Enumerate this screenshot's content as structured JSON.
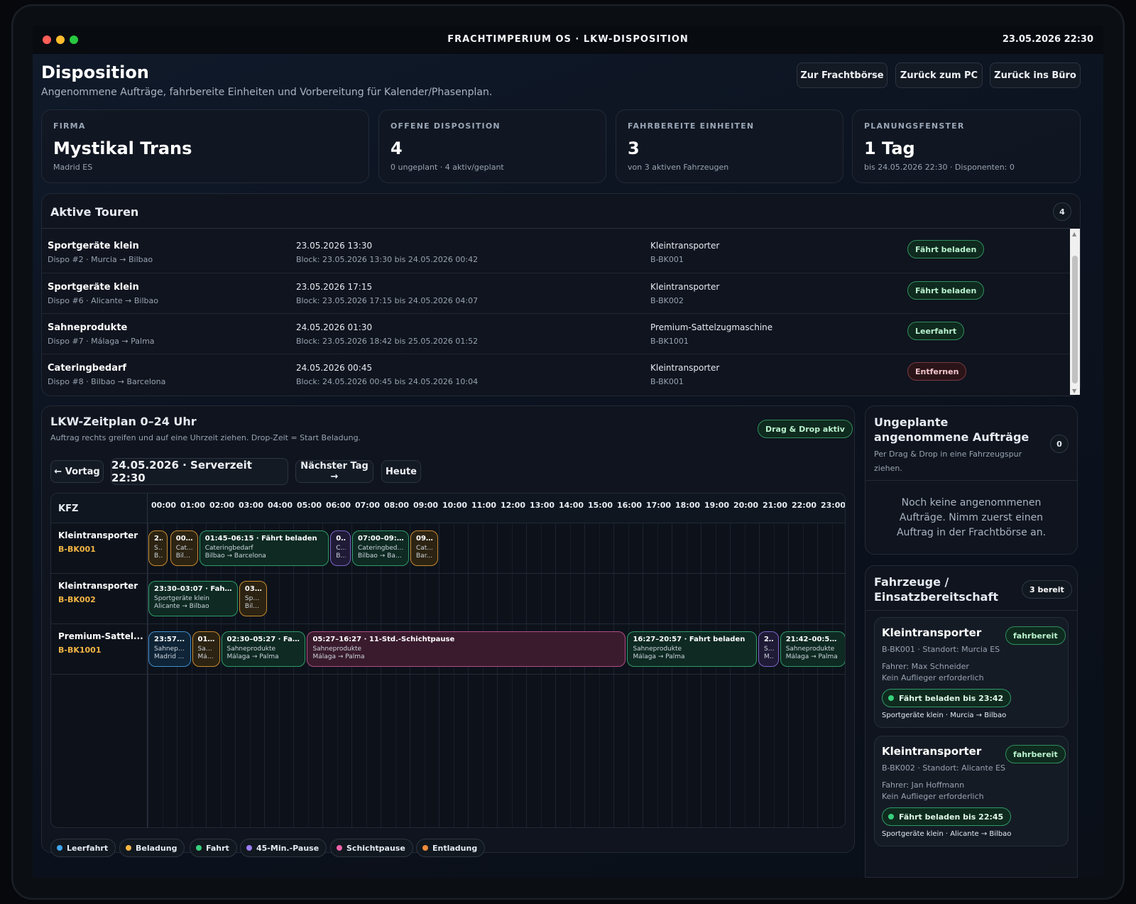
{
  "window": {
    "title": "FRACHTIMPERIUM OS · LKW-DISPOSITION",
    "datetime": "23.05.2026 22:30"
  },
  "header": {
    "title": "Disposition",
    "subtitle": "Angenommene Aufträge, fahrbereite Einheiten und Vorbereitung für Kalender/Phasenplan.",
    "buttons": {
      "freight": "Zur Frachtbörse",
      "pc": "Zurück zum PC",
      "office": "Zurück ins Büro"
    }
  },
  "stats": [
    {
      "label": "FIRMA",
      "value": "Mystikal Trans",
      "sub": "Madrid ES"
    },
    {
      "label": "OFFENE DISPOSITION",
      "value": "4",
      "sub": "0 ungeplant · 4 aktiv/geplant"
    },
    {
      "label": "FAHRBEREITE EINHEITEN",
      "value": "3",
      "sub": "von 3 aktiven Fahrzeugen"
    },
    {
      "label": "PLANUNGSFENSTER",
      "value": "1 Tag",
      "sub": "bis 24.05.2026 22:30 · Disponenten: 0"
    }
  ],
  "tours": {
    "title": "Aktive Touren",
    "count": "4",
    "rows": [
      {
        "cargo": "Sportgeräte klein",
        "dispo": "Dispo #2 · Murcia → Bilbao",
        "time": "23.05.2026 13:30",
        "block": "Block: 23.05.2026 13:30 bis 24.05.2026 00:42",
        "vehicle": "Kleintransporter",
        "plate": "B-BK001",
        "status": "Fährt beladen",
        "status_type": "green"
      },
      {
        "cargo": "Sportgeräte klein",
        "dispo": "Dispo #6 · Alicante → Bilbao",
        "time": "23.05.2026 17:15",
        "block": "Block: 23.05.2026 17:15 bis 24.05.2026 04:07",
        "vehicle": "Kleintransporter",
        "plate": "B-BK002",
        "status": "Fährt beladen",
        "status_type": "green"
      },
      {
        "cargo": "Sahneprodukte",
        "dispo": "Dispo #7 · Málaga → Palma",
        "time": "24.05.2026 01:30",
        "block": "Block: 23.05.2026 18:42 bis 25.05.2026 01:52",
        "vehicle": "Premium-Sattelzugmaschine",
        "plate": "B-BK1001",
        "status": "Leerfahrt",
        "status_type": "green"
      },
      {
        "cargo": "Cateringbedarf",
        "dispo": "Dispo #8 · Bilbao → Barcelona",
        "time": "24.05.2026 00:45",
        "block": "Block: 24.05.2026 00:45 bis 24.05.2026 10:04",
        "vehicle": "Kleintransporter",
        "plate": "B-BK001",
        "status": "Entfernen",
        "status_type": "red"
      }
    ]
  },
  "schedule": {
    "title": "LKW-Zeitplan 0–24 Uhr",
    "subtitle": "Auftrag rechts greifen und auf eine Uhrzeit ziehen. Drop-Zeit = Start Beladung.",
    "dnd_badge": "Drag & Drop aktiv",
    "prev_day": "← Vortag",
    "current": "24.05.2026 · Serverzeit 22:30",
    "next_day": "Nächster Tag →",
    "today": "Heute",
    "kfz_header": "KFZ",
    "hours": [
      "00:00",
      "01:00",
      "02:00",
      "03:00",
      "04:00",
      "05:00",
      "06:00",
      "07:00",
      "08:00",
      "09:00",
      "10:00",
      "11:00",
      "12:00",
      "13:00",
      "14:00",
      "15:00",
      "16:00",
      "17:00",
      "18:00",
      "19:00",
      "20:00",
      "21:00",
      "22:00",
      "23:00"
    ],
    "rows": [
      {
        "name": "Kleintransporter",
        "plate": "B-BK001",
        "blocks": [
          {
            "start": 0.0,
            "end": 0.7,
            "kind": "orange",
            "title": "2...",
            "sub": "S...",
            "route": "B..."
          },
          {
            "start": 0.75,
            "end": 1.75,
            "kind": "orange",
            "title": "00...",
            "sub": "Cat...",
            "route": "Bilb..."
          },
          {
            "start": 1.75,
            "end": 6.25,
            "kind": "green",
            "title": "01:45–06:15 · Fährt beladen",
            "sub": "Cateringbedarf",
            "route": "Bilbao → Barcelona"
          },
          {
            "start": 6.25,
            "end": 7.0,
            "kind": "purple",
            "title": "0...",
            "sub": "C...",
            "route": "B..."
          },
          {
            "start": 7.0,
            "end": 9.0,
            "kind": "green",
            "title": "07:00–09:0...",
            "sub": "Cateringbedarf",
            "route": "Bilbao → Barc..."
          },
          {
            "start": 9.0,
            "end": 10.0,
            "kind": "orange",
            "title": "09...",
            "sub": "Cat...",
            "route": "Bar..."
          }
        ]
      },
      {
        "name": "Kleintransporter",
        "plate": "B-BK002",
        "blocks": [
          {
            "start": 0.0,
            "end": 3.12,
            "kind": "green",
            "title": "23:30–03:07 · Fahr...",
            "sub": "Sportgeräte klein",
            "route": "Alicante → Bilbao"
          },
          {
            "start": 3.12,
            "end": 4.12,
            "kind": "orange",
            "title": "03...",
            "sub": "Spo...",
            "route": "Bilb..."
          }
        ]
      },
      {
        "name": "Premium-Sattel...",
        "plate": "B-BK1001",
        "blocks": [
          {
            "start": 0.0,
            "end": 1.5,
            "kind": "blue",
            "title": "23:57...",
            "sub": "Sahnepr...",
            "route": "Madrid ..."
          },
          {
            "start": 1.5,
            "end": 2.5,
            "kind": "orange",
            "title": "01...",
            "sub": "Sah...",
            "route": "Mál..."
          },
          {
            "start": 2.5,
            "end": 5.45,
            "kind": "green",
            "title": "02:30–05:27 · Fah...",
            "sub": "Sahneprodukte",
            "route": "Málaga → Palma"
          },
          {
            "start": 5.45,
            "end": 16.45,
            "kind": "pink",
            "title": "05:27–16:27 · 11-Std.-Schichtpause",
            "sub": "Sahneprodukte",
            "route": "Málaga → Palma"
          },
          {
            "start": 16.45,
            "end": 20.95,
            "kind": "green",
            "title": "16:27–20:57 · Fahrt beladen",
            "sub": "Sahneprodukte",
            "route": "Málaga → Palma"
          },
          {
            "start": 20.95,
            "end": 21.7,
            "kind": "purple",
            "title": "2...",
            "sub": "S...",
            "route": "M..."
          },
          {
            "start": 21.7,
            "end": 24.0,
            "kind": "green",
            "title": "21:42–00:52 ...",
            "sub": "Sahneprodukte",
            "route": "Málaga → Palma"
          }
        ]
      }
    ],
    "legend": [
      {
        "label": "Leerfahrt",
        "color": "#3fa7f0"
      },
      {
        "label": "Beladung",
        "color": "#f2b544"
      },
      {
        "label": "Fahrt",
        "color": "#37d07c"
      },
      {
        "label": "45-Min.-Pause",
        "color": "#9b7df0"
      },
      {
        "label": "Schichtpause",
        "color": "#f062a8"
      },
      {
        "label": "Entladung",
        "color": "#f08a3a"
      }
    ]
  },
  "unplanned": {
    "title": "Ungeplante angenommene Aufträge",
    "subtitle": "Per Drag & Drop in eine Fahrzeugspur ziehen.",
    "count": "0",
    "empty": "Noch keine angenommenen Aufträge. Nimm zuerst einen Auftrag in der Frachtbörse an."
  },
  "vehicles": {
    "title": "Fahrzeuge / Einsatzbereitschaft",
    "badge": "3 bereit",
    "items": [
      {
        "name": "Kleintransporter",
        "badge": "fahrbereit",
        "sub": "B-BK001 · Standort: Murcia ES",
        "driver": "Fahrer: Max Schneider",
        "trailer": "Kein Auflieger erforderlich",
        "status": "Fährt beladen bis 23:42",
        "route": "Sportgeräte klein · Murcia → Bilbao"
      },
      {
        "name": "Kleintransporter",
        "badge": "fahrbereit",
        "sub": "B-BK002 · Standort: Alicante ES",
        "driver": "Fahrer: Jan Hoffmann",
        "trailer": "Kein Auflieger erforderlich",
        "status": "Fährt beladen bis 22:45",
        "route": "Sportgeräte klein · Alicante → Bilbao"
      }
    ]
  }
}
